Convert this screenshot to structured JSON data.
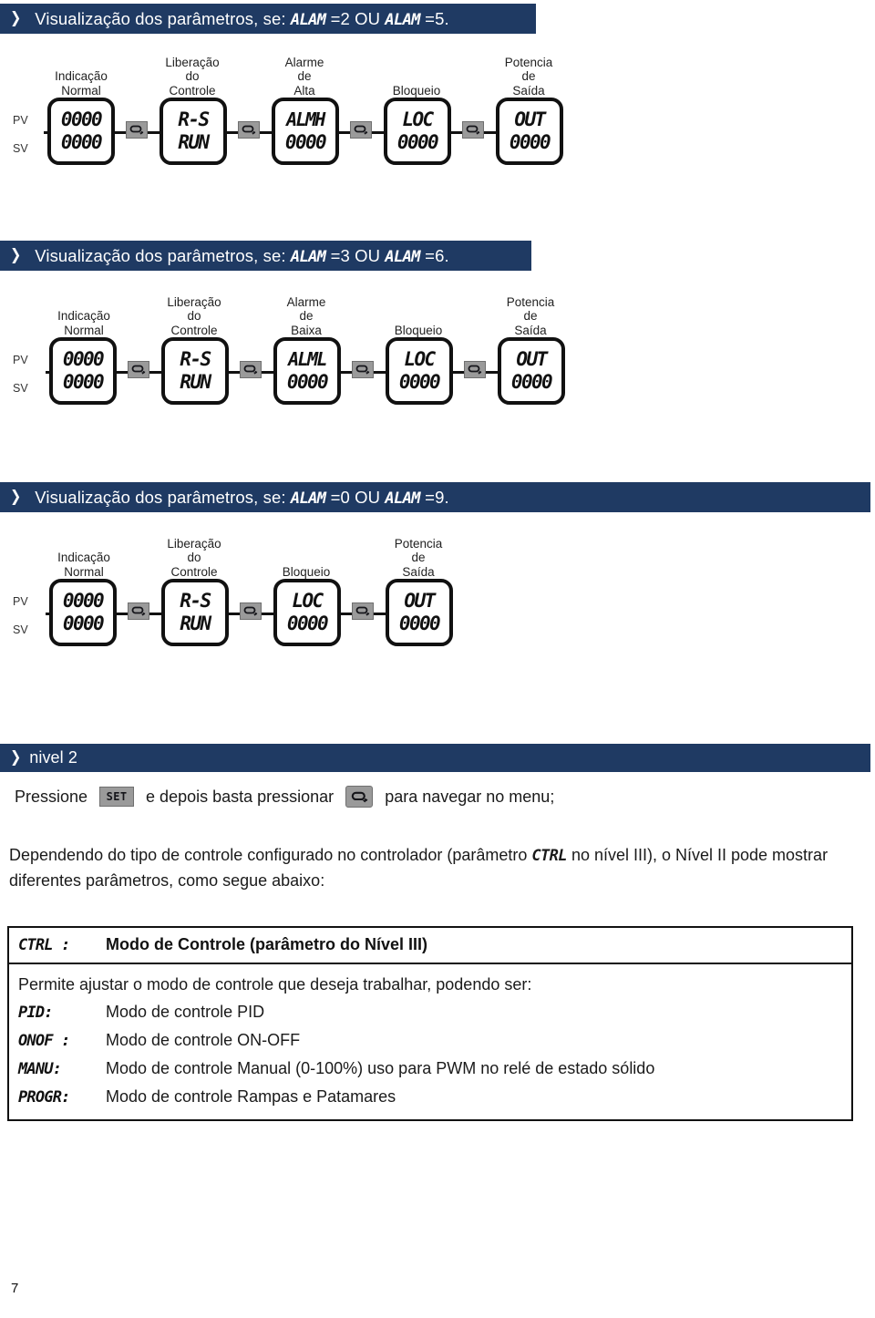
{
  "sections": [
    {
      "header": {
        "chevron_icon": "chevron-right-icon",
        "prefix": "Visualização dos parâmetros, se: ",
        "code1": "ALAM",
        "mid1": " =2  OU  ",
        "code2": "ALAM",
        "suffix": " =5."
      },
      "diagram": {
        "pv_label": "PV",
        "sv_label": "SV",
        "panels": [
          {
            "caption": [
              "Indicação",
              "Normal"
            ],
            "top": "0000",
            "bottom": "0000"
          },
          {
            "caption": [
              "Liberação",
              "do",
              "Controle"
            ],
            "top": "R-S",
            "bottom": "RUN"
          },
          {
            "caption": [
              "Alarme",
              "de",
              "Alta"
            ],
            "top": "ALMH",
            "bottom": "0000"
          },
          {
            "caption": [
              "Bloqueio"
            ],
            "top": "LOC",
            "bottom": "0000"
          },
          {
            "caption": [
              "Potencia",
              "de",
              "Saída"
            ],
            "top": "OUT",
            "bottom": "0000"
          }
        ],
        "connector_icon": "loop-arrow-icon"
      }
    },
    {
      "header": {
        "chevron_icon": "chevron-right-icon",
        "prefix": "Visualização dos parâmetros, se: ",
        "code1": "ALAM",
        "mid1": " =3 OU  ",
        "code2": "ALAM",
        "suffix": " =6."
      },
      "diagram": {
        "pv_label": "PV",
        "sv_label": "SV",
        "panels": [
          {
            "caption": [
              "Indicação",
              "Normal"
            ],
            "top": "0000",
            "bottom": "0000"
          },
          {
            "caption": [
              "Liberação",
              "do",
              "Controle"
            ],
            "top": "R-S",
            "bottom": "RUN"
          },
          {
            "caption": [
              "Alarme",
              "de",
              "Baixa"
            ],
            "top": "ALML",
            "bottom": "0000"
          },
          {
            "caption": [
              "Bloqueio"
            ],
            "top": "LOC",
            "bottom": "0000"
          },
          {
            "caption": [
              "Potencia",
              "de",
              "Saída"
            ],
            "top": "OUT",
            "bottom": "0000"
          }
        ],
        "connector_icon": "loop-arrow-icon"
      }
    },
    {
      "header": {
        "chevron_icon": "chevron-right-icon",
        "prefix": "Visualização dos parâmetros, se: ",
        "code1": "ALAM",
        "mid1": " =0 OU ",
        "code2": "ALAM",
        "suffix": " =9."
      },
      "diagram": {
        "pv_label": "PV",
        "sv_label": "SV",
        "panels": [
          {
            "caption": [
              "Indicação",
              "Normal"
            ],
            "top": "0000",
            "bottom": "0000"
          },
          {
            "caption": [
              "Liberação",
              "do",
              "Controle"
            ],
            "top": "R-S",
            "bottom": "RUN"
          },
          {
            "caption": [
              "Bloqueio"
            ],
            "top": "LOC",
            "bottom": "0000"
          },
          {
            "caption": [
              "Potencia",
              "de",
              "Saída"
            ],
            "top": "OUT",
            "bottom": "0000"
          }
        ],
        "connector_icon": "loop-arrow-icon"
      }
    }
  ],
  "level_section": {
    "header": {
      "chevron_icon": "chevron-right-icon",
      "title": "nivel 2"
    },
    "instruction": {
      "part1": "Pressione",
      "set_key_label": "SET",
      "part2": "e depois basta pressionar",
      "loop_key_icon": "loop-arrow-icon",
      "part3": "para navegar no menu;"
    },
    "paragraph": {
      "before": "Dependendo do tipo de controle configurado no controlador (parâmetro ",
      "code": "CTRL",
      "after": " no nível III), o Nível II pode mostrar diferentes parâmetros, como segue abaixo:"
    }
  },
  "param_table": {
    "header": {
      "code": "CTRL :",
      "title": "Modo de Controle (parâmetro do Nível III)"
    },
    "intro": "Permite ajustar o modo de controle que deseja trabalhar, podendo ser:",
    "options": [
      {
        "code": "PID:",
        "desc": "Modo de controle PID"
      },
      {
        "code": "ONOF :",
        "desc": "Modo de controle ON-OFF"
      },
      {
        "code": "MANU:",
        "desc": "Modo de controle Manual (0-100%) uso para PWM no relé de estado sólido"
      },
      {
        "code": "PROGR:",
        "desc": "Modo de controle Rampas e Patamares"
      }
    ]
  },
  "footer": {
    "page_number": "7"
  },
  "colors": {
    "header_bar": "#1f3a63",
    "header_text": "#ffffff",
    "key_button": "#9a9a9a",
    "body_text": "#1a1a1a"
  }
}
